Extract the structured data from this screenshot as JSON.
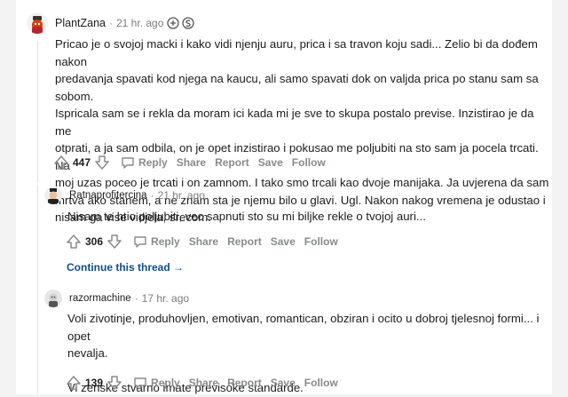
{
  "comments": [
    {
      "user": "PlantZana",
      "time": "21 hr. ago",
      "text": [
        "Pricao je o svojoj macki i kako vidi njenju auru, prica i sa travon koju sadi... Zelio bi da dođem nakon",
        "predavanja spavati kod njega na kaucu, ali samo spavati dok on valjda prica po stanu sam sa sobom.",
        "Ispricala sam se i rekla da moram ici kada mi je sve to skupa postalo previse. Inzistirao je da me",
        "otprati, a ja sam odbila, on je opet inzistirao i pokusao me poljubiti na sto sam ja pocela trcati. Na",
        "moj uzas poceo je trcati i on zamnom. I tako smo trcali kao dvoje manijaka. Ja uvjerena da sam",
        "mrtva ako stanem, a ne znam sta je njemu bilo u glavi. Ugl. Nakon nakog vremena je odustao i",
        "nisam ga vise vidjela, srecom."
      ],
      "score": "447"
    },
    {
      "user": "Ratnaprofitercina",
      "time": "21 hr. ago",
      "text": [
        "Nisam te htio poljubiti, vec sapnuti sto su mi biljke rekle o tvojoj auri..."
      ],
      "score": "306"
    },
    {
      "user": "razormachine",
      "time": "17 hr. ago",
      "text": [
        "Voli zivotinje, produhovljen, emotivan, romantican, obziran i ocito u dobroj tjelesnoj formi... i opet",
        "nevalja.",
        "",
        "Vi zenske stvarno imate previsoke standarde."
      ],
      "score": "139"
    }
  ],
  "actions": {
    "reply": "Reply",
    "share": "Share",
    "report": "Report",
    "save": "Save",
    "follow": "Follow"
  },
  "continue_thread": "Continue this thread →",
  "dot": "·",
  "colors": {
    "link": "#0f4d8a",
    "muted": "#878a8c",
    "line": "#e1e3e5"
  }
}
